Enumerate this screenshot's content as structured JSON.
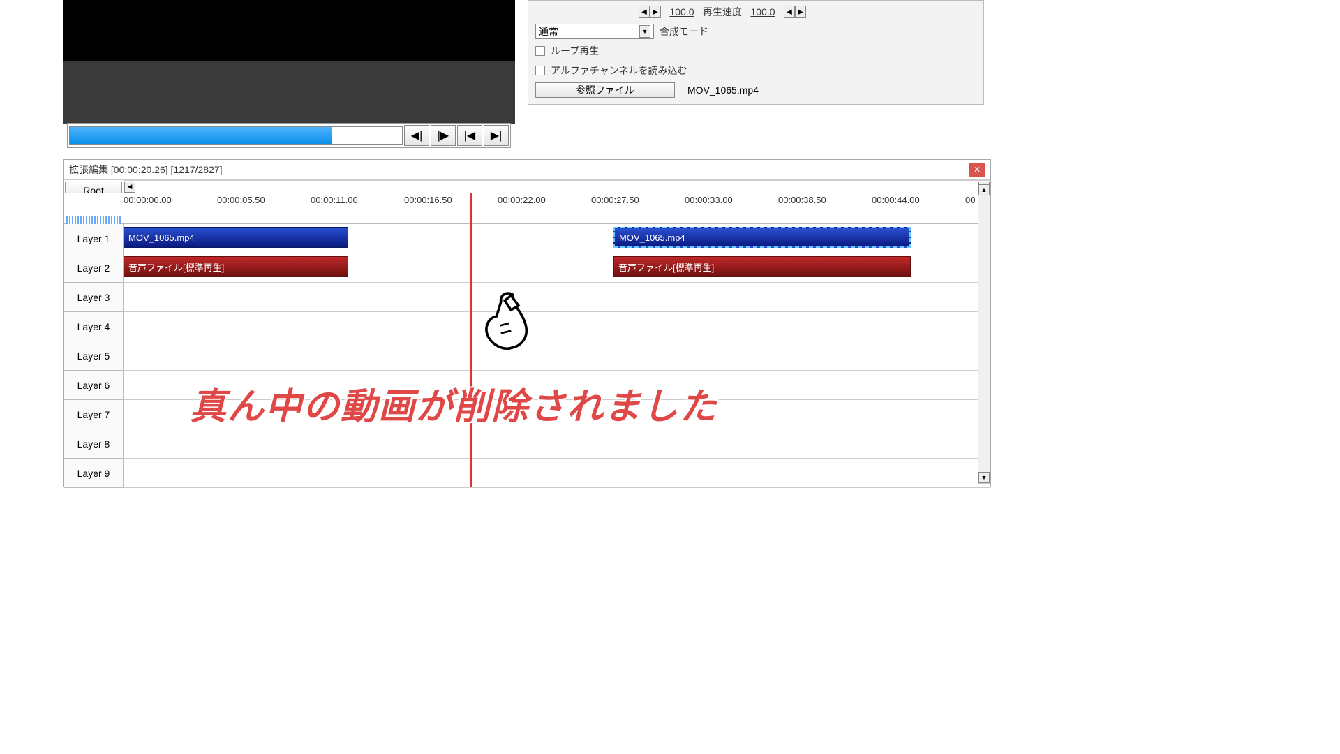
{
  "preview": {
    "transport_icons": [
      "◀|",
      "|▶",
      "|◀",
      "▶|"
    ]
  },
  "props": {
    "val1": "100.0",
    "speed_label": "再生速度",
    "val2": "100.0",
    "blend_value": "通常",
    "blend_label": "合成モード",
    "loop_label": "ループ再生",
    "alpha_label": "アルファチャンネルを読み込む",
    "ref_button": "参照ファイル",
    "ref_value": "MOV_1065.mp4"
  },
  "timeline": {
    "title": "拡張編集 [00:00:20.26] [1217/2827]",
    "root": "Root",
    "ruler": [
      "00:00:00.00",
      "00:00:05.50",
      "00:00:11.00",
      "00:00:16.50",
      "00:00:22.00",
      "00:00:27.50",
      "00:00:33.00",
      "00:00:38.50",
      "00:00:44.00",
      "00"
    ],
    "layers": [
      "Layer 1",
      "Layer 2",
      "Layer 3",
      "Layer 4",
      "Layer 5",
      "Layer 6",
      "Layer 7",
      "Layer 8",
      "Layer 9"
    ],
    "clips": {
      "v1": "MOV_1065.mp4",
      "v2": "MOV_1065.mp4",
      "a1": "音声ファイル[標準再生]",
      "a2": "音声ファイル[標準再生]"
    }
  },
  "overlay": "真ん中の動画が削除されました"
}
